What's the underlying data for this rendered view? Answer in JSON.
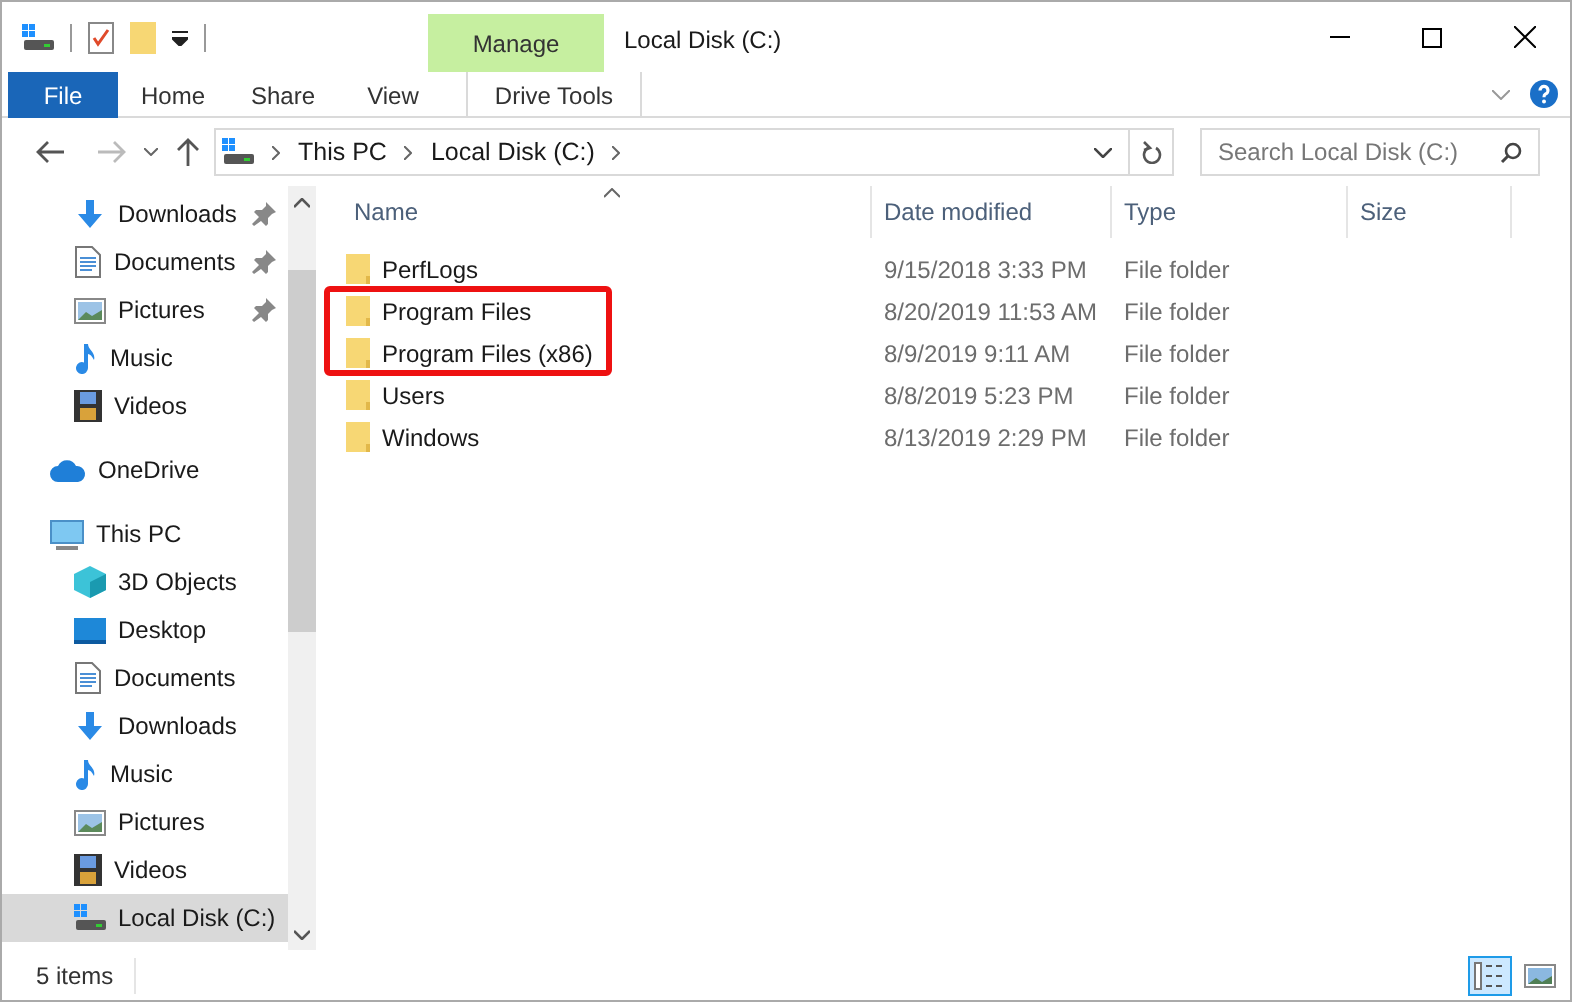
{
  "window": {
    "title": "Local Disk (C:)"
  },
  "context_tab": {
    "label": "Manage",
    "sub_label": "Drive Tools"
  },
  "ribbon_tabs": [
    {
      "label": "File",
      "kind": "file",
      "selected": false
    },
    {
      "label": "Home",
      "kind": "tab",
      "selected": false
    },
    {
      "label": "Share",
      "kind": "tab",
      "selected": false
    },
    {
      "label": "View",
      "kind": "tab",
      "selected": false
    }
  ],
  "address_bar": {
    "path": [
      "This PC",
      "Local Disk (C:)"
    ]
  },
  "search": {
    "placeholder": "Search Local Disk (C:)"
  },
  "sidebar": {
    "quick_access": [
      {
        "label": "Downloads",
        "kind": "downloads",
        "pinned": true,
        "selected": false
      },
      {
        "label": "Documents",
        "kind": "documents",
        "pinned": true,
        "selected": false
      },
      {
        "label": "Pictures",
        "kind": "pictures",
        "pinned": true,
        "selected": false
      },
      {
        "label": "Music",
        "kind": "music",
        "pinned": false,
        "selected": false
      },
      {
        "label": "Videos",
        "kind": "videos",
        "pinned": false,
        "selected": false
      }
    ],
    "items": [
      {
        "label": "OneDrive",
        "kind": "cloud",
        "selected": false
      },
      {
        "label": "This PC",
        "kind": "pc",
        "selected": false,
        "children": [
          {
            "label": "3D Objects",
            "kind": "objects",
            "selected": false
          },
          {
            "label": "Desktop",
            "kind": "desktop",
            "selected": false
          },
          {
            "label": "Documents",
            "kind": "documents",
            "selected": false
          },
          {
            "label": "Downloads",
            "kind": "downloads",
            "selected": false
          },
          {
            "label": "Music",
            "kind": "music",
            "selected": false
          },
          {
            "label": "Pictures",
            "kind": "pictures",
            "selected": false
          },
          {
            "label": "Videos",
            "kind": "videos",
            "selected": false
          },
          {
            "label": "Local Disk (C:)",
            "kind": "drive",
            "selected": true
          }
        ]
      }
    ]
  },
  "table": {
    "columns": [
      "Name",
      "Date modified",
      "Type",
      "Size"
    ],
    "rows": [
      {
        "name": "PerfLogs",
        "date": "9/15/2018 3:33 PM",
        "type": "File folder",
        "highlighted": false
      },
      {
        "name": "Program Files",
        "date": "8/20/2019 11:53 AM",
        "type": "File folder",
        "highlighted": true
      },
      {
        "name": "Program Files (x86)",
        "date": "8/9/2019 9:11 AM",
        "type": "File folder",
        "highlighted": true
      },
      {
        "name": "Users",
        "date": "8/8/2019 5:23 PM",
        "type": "File folder",
        "highlighted": false
      },
      {
        "name": "Windows",
        "date": "8/13/2019 2:29 PM",
        "type": "File folder",
        "highlighted": false
      }
    ]
  },
  "status_bar": {
    "count": "5 items",
    "views": [
      {
        "kind": "details",
        "selected": true
      },
      {
        "kind": "large",
        "selected": false
      }
    ]
  }
}
